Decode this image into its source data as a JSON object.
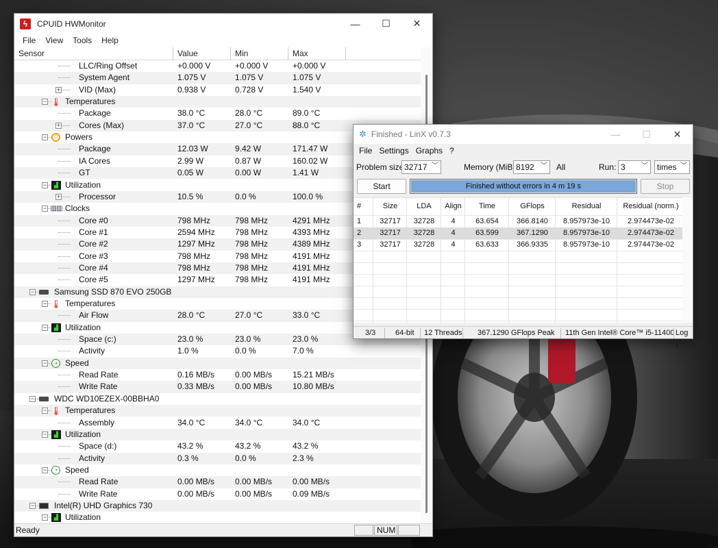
{
  "hwmonitor": {
    "title": "CPUID HWMonitor",
    "menu": [
      "File",
      "View",
      "Tools",
      "Help"
    ],
    "columns": {
      "sensor": "Sensor",
      "value": "Value",
      "min": "Min",
      "max": "Max"
    },
    "rows": [
      {
        "label": "LLC/Ring Offset",
        "value": "+0.000 V",
        "min": "+0.000 V",
        "max": "+0.000 V",
        "level": 3
      },
      {
        "label": "System Agent",
        "value": "1.075 V",
        "min": "1.075 V",
        "max": "1.075 V",
        "level": 3
      },
      {
        "label": "VID (Max)",
        "value": "0.938 V",
        "min": "0.728 V",
        "max": "1.540 V",
        "level": 3,
        "expander": "+"
      },
      {
        "label": "Temperatures",
        "level": 2,
        "icon": "thermometer-icon",
        "expander": "-"
      },
      {
        "label": "Package",
        "value": "38.0 °C",
        "min": "28.0 °C",
        "max": "89.0 °C",
        "level": 3
      },
      {
        "label": "Cores (Max)",
        "value": "37.0 °C",
        "min": "27.0 °C",
        "max": "88.0 °C",
        "level": 3,
        "expander": "+"
      },
      {
        "label": "Powers",
        "level": 2,
        "icon": "power-icon",
        "expander": "-"
      },
      {
        "label": "Package",
        "value": "12.03 W",
        "min": "9.42 W",
        "max": "171.47 W",
        "level": 3
      },
      {
        "label": "IA Cores",
        "value": "2.99 W",
        "min": "0.87 W",
        "max": "160.02 W",
        "level": 3
      },
      {
        "label": "GT",
        "value": "0.05 W",
        "min": "0.00 W",
        "max": "1.41 W",
        "level": 3
      },
      {
        "label": "Utilization",
        "level": 2,
        "icon": "utilization-icon",
        "expander": "-"
      },
      {
        "label": "Processor",
        "value": "10.5 %",
        "min": "0.0 %",
        "max": "100.0 %",
        "level": 3,
        "expander": "+"
      },
      {
        "label": "Clocks",
        "level": 2,
        "icon": "clock-icon",
        "expander": "-"
      },
      {
        "label": "Core #0",
        "value": "798 MHz",
        "min": "798 MHz",
        "max": "4291 MHz",
        "level": 3
      },
      {
        "label": "Core #1",
        "value": "2594 MHz",
        "min": "798 MHz",
        "max": "4393 MHz",
        "level": 3
      },
      {
        "label": "Core #2",
        "value": "1297 MHz",
        "min": "798 MHz",
        "max": "4389 MHz",
        "level": 3
      },
      {
        "label": "Core #3",
        "value": "798 MHz",
        "min": "798 MHz",
        "max": "4191 MHz",
        "level": 3
      },
      {
        "label": "Core #4",
        "value": "798 MHz",
        "min": "798 MHz",
        "max": "4191 MHz",
        "level": 3
      },
      {
        "label": "Core #5",
        "value": "1297 MHz",
        "min": "798 MHz",
        "max": "4191 MHz",
        "level": 3
      },
      {
        "label": "Samsung SSD 870 EVO 250GB",
        "level": 1,
        "icon": "drive-icon",
        "expander": "-"
      },
      {
        "label": "Temperatures",
        "level": 2,
        "icon": "thermometer-icon",
        "expander": "-"
      },
      {
        "label": "Air Flow",
        "value": "28.0 °C",
        "min": "27.0 °C",
        "max": "33.0 °C",
        "level": 3
      },
      {
        "label": "Utilization",
        "level": 2,
        "icon": "utilization-icon",
        "expander": "-"
      },
      {
        "label": "Space (c:)",
        "value": "23.0 %",
        "min": "23.0 %",
        "max": "23.0 %",
        "level": 3
      },
      {
        "label": "Activity",
        "value": "1.0 %",
        "min": "0.0 %",
        "max": "7.0 %",
        "level": 3
      },
      {
        "label": "Speed",
        "level": 2,
        "icon": "speed-icon",
        "expander": "-"
      },
      {
        "label": "Read Rate",
        "value": "0.16 MB/s",
        "min": "0.00 MB/s",
        "max": "15.21 MB/s",
        "level": 3
      },
      {
        "label": "Write Rate",
        "value": "0.33 MB/s",
        "min": "0.00 MB/s",
        "max": "10.80 MB/s",
        "level": 3
      },
      {
        "label": "WDC WD10EZEX-00BBHA0",
        "level": 1,
        "icon": "drive-icon",
        "expander": "-"
      },
      {
        "label": "Temperatures",
        "level": 2,
        "icon": "thermometer-icon",
        "expander": "-"
      },
      {
        "label": "Assembly",
        "value": "34.0 °C",
        "min": "34.0 °C",
        "max": "34.0 °C",
        "level": 3
      },
      {
        "label": "Utilization",
        "level": 2,
        "icon": "utilization-icon",
        "expander": "-"
      },
      {
        "label": "Space (d:)",
        "value": "43.2 %",
        "min": "43.2 %",
        "max": "43.2 %",
        "level": 3
      },
      {
        "label": "Activity",
        "value": "0.3 %",
        "min": "0.0 %",
        "max": "2.3 %",
        "level": 3
      },
      {
        "label": "Speed",
        "level": 2,
        "icon": "speed-icon",
        "expander": "-"
      },
      {
        "label": "Read Rate",
        "value": "0.00 MB/s",
        "min": "0.00 MB/s",
        "max": "0.00 MB/s",
        "level": 3
      },
      {
        "label": "Write Rate",
        "value": "0.00 MB/s",
        "min": "0.00 MB/s",
        "max": "0.09 MB/s",
        "level": 3
      },
      {
        "label": "Intel(R) UHD Graphics 730",
        "level": 1,
        "icon": "gpu-icon",
        "expander": "-"
      },
      {
        "label": "Utilization",
        "level": 2,
        "icon": "utilization-icon",
        "expander": "-"
      }
    ],
    "status": {
      "ready": "Ready",
      "num": "NUM"
    }
  },
  "linx": {
    "title": "Finished - LinX v0.7.3",
    "menu": [
      "File",
      "Settings",
      "Graphs",
      "?"
    ],
    "problem_size_label": "Problem size:",
    "problem_size_value": "32717",
    "memory_label": "Memory (MiB):",
    "memory_value": "8192",
    "all_label": "All",
    "run_label": "Run:",
    "run_value": "3",
    "run_unit": "times",
    "start_label": "Start",
    "stop_label": "Stop",
    "progress_text": "Finished without errors in 4 m 19 s",
    "progress_fraction": 1.0,
    "columns": [
      "#",
      "Size",
      "LDA",
      "Align",
      "Time",
      "GFlops",
      "Residual",
      "Residual (norm.)"
    ],
    "rows": [
      [
        "1",
        "32717",
        "32728",
        "4",
        "63.654",
        "366.8140",
        "8.957973e-10",
        "2.974473e-02"
      ],
      [
        "2",
        "32717",
        "32728",
        "4",
        "63.599",
        "367.1290",
        "8.957973e-10",
        "2.974473e-02"
      ],
      [
        "3",
        "32717",
        "32728",
        "4",
        "63.633",
        "366.9335",
        "8.957973e-10",
        "2.974473e-02"
      ]
    ],
    "selected_row": 1,
    "status": {
      "progress": "3/3",
      "bits": "64-bit",
      "threads": "12 Threads",
      "peak": "367.1290 GFlops Peak",
      "cpu": "11th Gen Intel® Core™ i5-11400",
      "log": "Log ›"
    }
  }
}
